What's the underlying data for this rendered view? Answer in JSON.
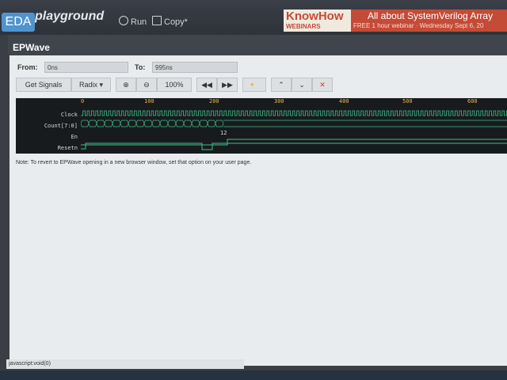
{
  "header": {
    "logo_box": "EDA",
    "logo_text": "playground",
    "run_label": "Run",
    "copy_label": "Copy*"
  },
  "banner": {
    "brand": "KnowHow",
    "brand_sub": "WEBINARS",
    "headline": "All about SystemVerilog Array",
    "subline": "FREE 1 hour webinar · Wednesday Sept 6, 20"
  },
  "panel": {
    "title": "EPWave"
  },
  "range": {
    "from_label": "From:",
    "from_value": "0ns",
    "to_label": "To:",
    "to_value": "995ns"
  },
  "toolbar": {
    "get_signals": "Get Signals",
    "radix": "Radix ▾",
    "zoom_in": "⊕",
    "zoom_out": "⊖",
    "zoom_level": "100%",
    "prev": "◀◀",
    "next": "▶▶",
    "cursor": "✦ ·",
    "up": "⌃",
    "down": "⌄",
    "delete": "✕"
  },
  "waveform": {
    "signals": [
      "Clock",
      "Count[7:0]",
      "En",
      "Resetn"
    ],
    "ruler_ticks": [
      "0",
      "100",
      "200",
      "300",
      "400",
      "500",
      "600"
    ],
    "count_last_value": "12",
    "colors": {
      "bg": "#181b1e",
      "trace": "#3fbf8a",
      "ruler": "#e5b74a"
    }
  },
  "note": "Note: To revert to EPWave opening in a new browser window, set that option on your user page.",
  "status": "javascript:void(0)"
}
